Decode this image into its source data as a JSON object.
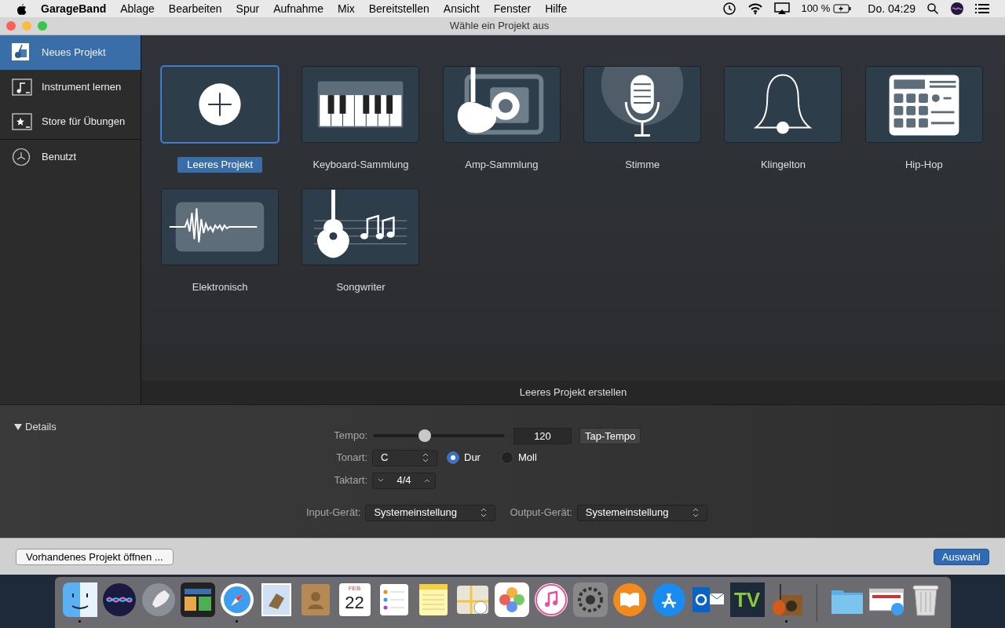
{
  "menu_bar": {
    "app_name": "GarageBand",
    "menus": [
      "Ablage",
      "Bearbeiten",
      "Spur",
      "Aufnahme",
      "Mix",
      "Bereitstellen",
      "Ansicht",
      "Fenster",
      "Hilfe"
    ],
    "battery": "100 %",
    "clock": "Do. 04:29"
  },
  "window": {
    "title": "Wähle ein Projekt aus"
  },
  "sidebar": {
    "items": [
      {
        "label": "Neues Projekt",
        "kind": "new",
        "selected": true
      },
      {
        "label": "Instrument lernen",
        "kind": "learn",
        "selected": false
      },
      {
        "label": "Store für Übungen",
        "kind": "store",
        "selected": false
      },
      {
        "label": "Benutzt",
        "kind": "recent",
        "selected": false
      }
    ]
  },
  "templates": [
    {
      "label": "Leeres Projekt",
      "kind": "empty",
      "selected": true
    },
    {
      "label": "Keyboard-Sammlung",
      "kind": "keyboard",
      "selected": false
    },
    {
      "label": "Amp-Sammlung",
      "kind": "amp",
      "selected": false
    },
    {
      "label": "Stimme",
      "kind": "voice",
      "selected": false
    },
    {
      "label": "Klingelton",
      "kind": "bell",
      "selected": false
    },
    {
      "label": "Hip-Hop",
      "kind": "hiphop",
      "selected": false
    },
    {
      "label": "Elektronisch",
      "kind": "electronic",
      "selected": false
    },
    {
      "label": "Songwriter",
      "kind": "songwriter",
      "selected": false
    }
  ],
  "action_label": "Leeres Projekt erstellen",
  "details": {
    "toggle": "Details",
    "expanded": true,
    "tempo": {
      "label": "Tempo:",
      "level": 0.39,
      "value": "120",
      "tap_button": "Tap-Tempo"
    },
    "key": {
      "label": "Tonart:",
      "value": "C",
      "modes": [
        {
          "label": "Dur",
          "selected": true
        },
        {
          "label": "Moll",
          "selected": false
        }
      ]
    },
    "time_signature": {
      "label": "Taktart:",
      "value": "4/4"
    },
    "input": {
      "label": "Input-Gerät:",
      "value": "Systemeinstellung"
    },
    "output": {
      "label": "Output-Gerät:",
      "value": "Systemeinstellung"
    }
  },
  "buttons": {
    "open": "Vorhandenes Projekt öffnen ...",
    "choose": "Auswahl"
  },
  "dock": [
    {
      "kind": "finder",
      "running": true
    },
    {
      "kind": "siri",
      "running": false
    },
    {
      "kind": "launchpad",
      "running": false
    },
    {
      "kind": "mission",
      "running": false
    },
    {
      "kind": "safari",
      "running": true
    },
    {
      "kind": "mail",
      "running": false
    },
    {
      "kind": "contacts",
      "running": false
    },
    {
      "kind": "calendar",
      "running": false,
      "month": "FEB",
      "day": "22"
    },
    {
      "kind": "reminders",
      "running": false
    },
    {
      "kind": "notes",
      "running": false
    },
    {
      "kind": "maps",
      "running": false
    },
    {
      "kind": "photos",
      "running": false
    },
    {
      "kind": "music",
      "running": false
    },
    {
      "kind": "settings",
      "running": false
    },
    {
      "kind": "books",
      "running": false
    },
    {
      "kind": "appstore",
      "running": false
    },
    {
      "kind": "outlook",
      "running": false
    },
    {
      "kind": "tv",
      "running": false,
      "text": "TV"
    },
    {
      "kind": "garageband",
      "running": true
    },
    {
      "kind": "folder",
      "running": false
    },
    {
      "kind": "browser",
      "running": false
    },
    {
      "kind": "trash",
      "running": false
    }
  ]
}
